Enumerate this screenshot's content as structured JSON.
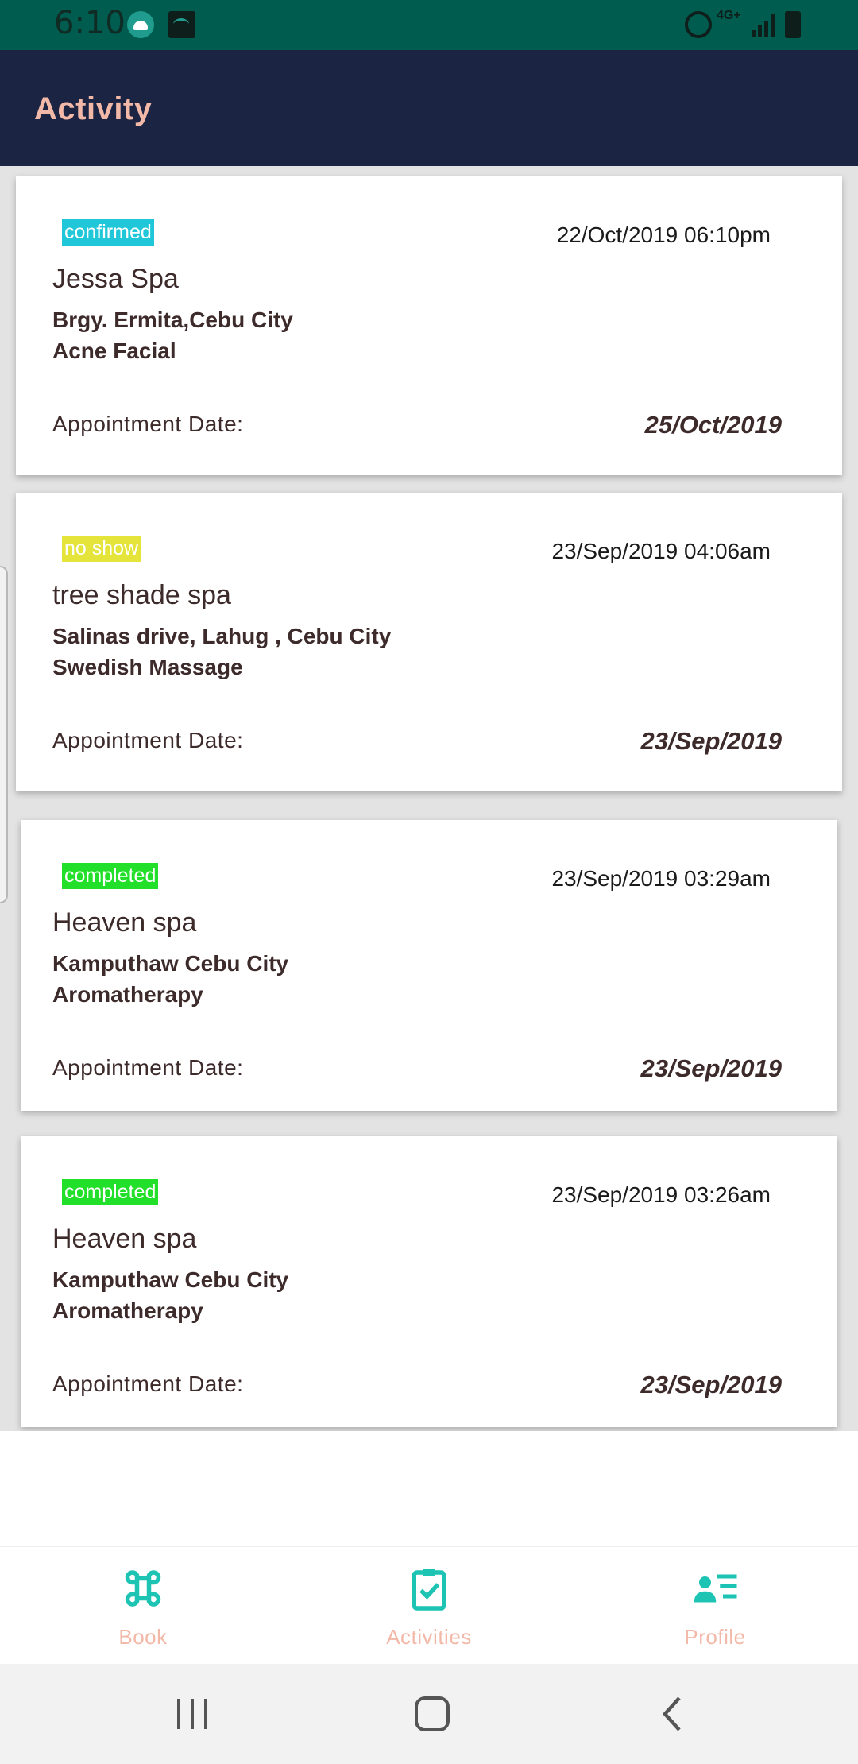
{
  "status_bar": {
    "time": "6:10",
    "network": "4G+",
    "icons": [
      "android-icon",
      "wifi-icon",
      "alarm-icon",
      "signal-icon",
      "battery-icon"
    ]
  },
  "app_bar": {
    "title": "Activity"
  },
  "activities": [
    {
      "status": "confirmed",
      "status_color": "#1fc7d8",
      "created": "22/Oct/2019 06:10pm",
      "spa": "Jessa Spa",
      "address": "Brgy. Ermita,Cebu City",
      "service": "Acne Facial",
      "appointment_label": "Appointment Date:",
      "appointment_date": "25/Oct/2019"
    },
    {
      "status": "no show",
      "status_color": "#e5e43a",
      "created": "23/Sep/2019 04:06am",
      "spa": "tree shade spa",
      "address": "Salinas drive, Lahug , Cebu City",
      "service": "Swedish Massage",
      "appointment_label": "Appointment Date:",
      "appointment_date": "23/Sep/2019"
    },
    {
      "status": "completed",
      "status_color": "#22e02a",
      "created": "23/Sep/2019 03:29am",
      "spa": "Heaven spa",
      "address": "Kamputhaw Cebu City",
      "service": "Aromatherapy",
      "appointment_label": "Appointment Date:",
      "appointment_date": "23/Sep/2019"
    },
    {
      "status": "completed",
      "status_color": "#22e02a",
      "created": "23/Sep/2019 03:26am",
      "spa": "Heaven spa",
      "address": "Kamputhaw Cebu City",
      "service": "Aromatherapy",
      "appointment_label": "Appointment Date:",
      "appointment_date": "23/Sep/2019"
    }
  ],
  "bottom_nav": {
    "items": [
      {
        "label": "Book",
        "icon": "command-icon"
      },
      {
        "label": "Activities",
        "icon": "clipboard-check-icon"
      },
      {
        "label": "Profile",
        "icon": "contact-list-icon"
      }
    ],
    "accent_color": "#1dc4b3",
    "label_color": "#f2b8a8"
  },
  "system_nav": {
    "buttons": [
      "recents-icon",
      "home-icon",
      "back-icon"
    ]
  },
  "colors": {
    "status_bar": "#005c4f",
    "app_bar": "#1b2442",
    "title": "#f2b8a8"
  }
}
